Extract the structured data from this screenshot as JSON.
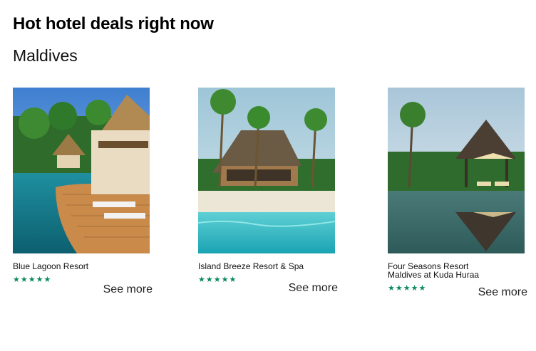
{
  "header": {
    "title": "Hot hotel deals right now",
    "location": "Maldives"
  },
  "hotels": [
    {
      "name": "Blue Lagoon Resort",
      "stars": "★★★★★",
      "rating": 5,
      "link_label": "See more"
    },
    {
      "name": "Island Breeze Resort & Spa",
      "stars": "★★★★★",
      "rating": 5,
      "link_label": "See more"
    },
    {
      "name": "Four Seasons Resort Maldives at Kuda Huraa",
      "stars": "★★★★★",
      "rating": 5,
      "link_label": "See more"
    }
  ],
  "colors": {
    "star": "#0a8a5a",
    "water": "#2fb6c4",
    "wood": "#c98a4a"
  }
}
